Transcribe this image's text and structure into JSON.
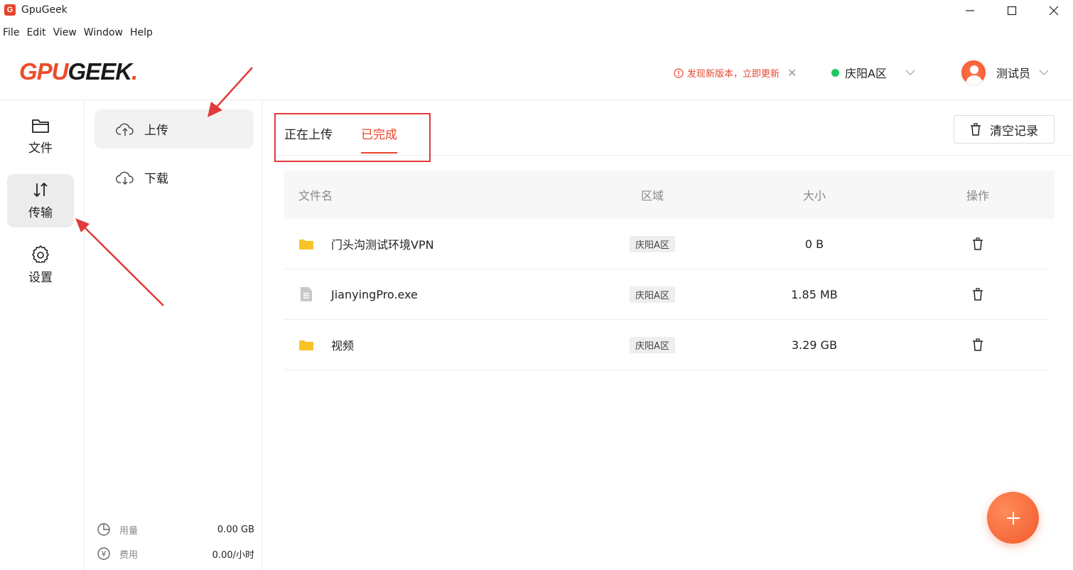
{
  "window": {
    "app_name": "GpuGeek",
    "icon_letter": "G"
  },
  "menu": [
    "File",
    "Edit",
    "View",
    "Window",
    "Help"
  ],
  "header": {
    "logo_part1": "GPU",
    "logo_part2": "GEEK",
    "logo_dot": ".",
    "update_notice": "发现新版本，立即更新",
    "region": "庆阳A区",
    "user_name": "测试员"
  },
  "nav": {
    "files": "文件",
    "transfer": "传输",
    "settings": "设置"
  },
  "subnav": {
    "upload": "上传",
    "download": "下载",
    "usage_label": "用量",
    "usage_value": "0.00 GB",
    "cost_label": "费用",
    "cost_value": "0.00/小时"
  },
  "tabs": {
    "uploading": "正在上传",
    "completed": "已完成"
  },
  "actions": {
    "clear_records": "清空记录"
  },
  "table": {
    "headers": {
      "name": "文件名",
      "region": "区域",
      "size": "大小",
      "ops": "操作"
    },
    "rows": [
      {
        "type": "folder",
        "name": "门头沟测试环境VPN",
        "region": "庆阳A区",
        "size": "0 B"
      },
      {
        "type": "file",
        "name": "JianyingPro.exe",
        "region": "庆阳A区",
        "size": "1.85 MB"
      },
      {
        "type": "folder",
        "name": "视频",
        "region": "庆阳A区",
        "size": "3.29 GB"
      }
    ]
  },
  "colors": {
    "accent": "#e8452c",
    "online": "#1ec861",
    "folder": "#f9c227"
  }
}
